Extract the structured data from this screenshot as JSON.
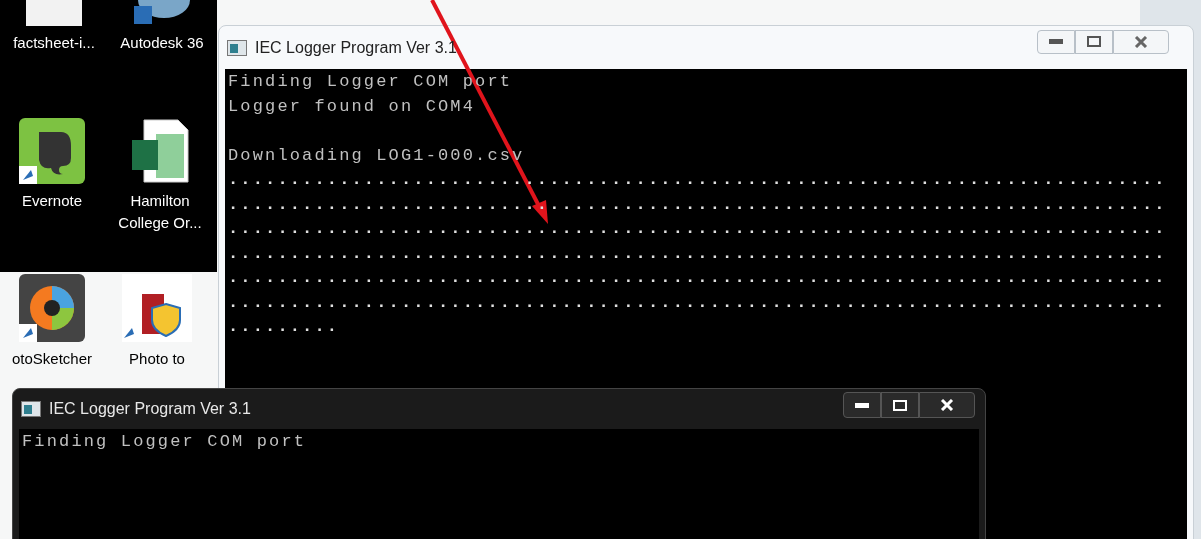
{
  "desktop_icons": [
    {
      "label": "factsheet-i...",
      "kind": "document"
    },
    {
      "label": "Autodesk 36",
      "kind": "cloud"
    },
    {
      "label": "Evernote",
      "kind": "elephant"
    },
    {
      "label": "Hamilton College Or...",
      "kind": "spreadsheet"
    },
    {
      "label": "otoSketcher",
      "kind": "swirl"
    },
    {
      "label": "Photo to",
      "kind": "shield"
    }
  ],
  "windows": [
    {
      "kind": "light",
      "title": "IEC Logger Program Ver 3.1",
      "lines": [
        "Finding Logger COM port",
        "Logger found on COM4"
      ],
      "download_line": "Downloading LOG1-000.csv",
      "progress": [
        "............................................................................",
        "............................................................................",
        "............................................................................",
        "............................................................................",
        "............................................................................",
        "............................................................................",
        "........."
      ]
    },
    {
      "kind": "dark",
      "title": "IEC Logger Program Ver 3.1",
      "lines": [
        "Finding Logger COM port"
      ]
    }
  ]
}
